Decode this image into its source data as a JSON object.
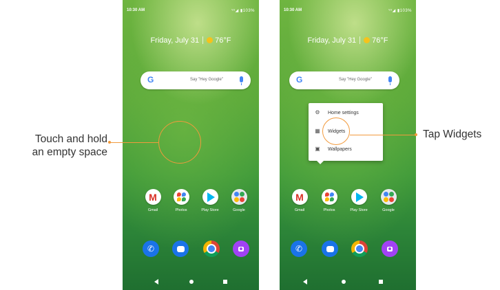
{
  "status": {
    "time": "10:30 AM",
    "icons": "ᵛᵒ◢ ▮103%"
  },
  "home": {
    "date": "Friday, July 31",
    "temperature": "76°F"
  },
  "search": {
    "logo": "G",
    "hint": "Say \"Hey Google\""
  },
  "apps": [
    {
      "label": "Gmail",
      "icon": "gmail-icon"
    },
    {
      "label": "Photos",
      "icon": "photos-icon"
    },
    {
      "label": "Play Store",
      "icon": "play-store-icon"
    },
    {
      "label": "Google",
      "icon": "google-folder-icon"
    }
  ],
  "dock": [
    "phone-icon",
    "messages-icon",
    "chrome-icon",
    "camera-icon"
  ],
  "menu": {
    "items": [
      {
        "label": "Home settings",
        "icon": "gear-icon"
      },
      {
        "label": "Widgets",
        "icon": "widgets-icon"
      },
      {
        "label": "Wallpapers",
        "icon": "wallpapers-icon"
      }
    ]
  },
  "callouts": {
    "left_line1": "Touch and hold",
    "left_line2": "an empty space",
    "right": "Tap Widgets"
  },
  "colors": {
    "accent": "#f29a3c",
    "wallpaper": "#4fa23a"
  }
}
